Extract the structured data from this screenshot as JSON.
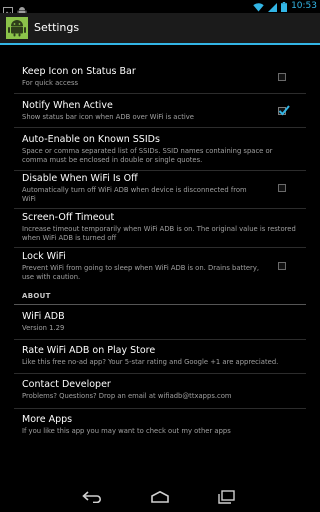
{
  "status_bar": {
    "time": "10:53"
  },
  "action_bar": {
    "title": "Settings"
  },
  "preferences": [
    {
      "title": "Keep Icon on Status Bar",
      "summary": "For quick access",
      "checked": false
    },
    {
      "title": "Notify When Active",
      "summary": "Show status bar icon when ADB over WiFi is active",
      "checked": true
    },
    {
      "title": "Auto-Enable on Known SSIDs",
      "summary": "Space or comma separated list of SSIDs. SSID names containing space or comma must be enclosed in double or single quotes."
    },
    {
      "title": "Disable When WiFi Is Off",
      "summary": "Automatically turn off WiFi ADB when device is disconnected from WiFi",
      "checked": false
    },
    {
      "title": "Screen-Off Timeout",
      "summary": "Increase timeout temporarily when WiFi ADB is on. The original value is restored when WiFi ADB is turned off"
    },
    {
      "title": "Lock WiFi",
      "summary": "Prevent WiFi from going to sleep when WiFi ADB is on. Drains battery, use with caution.",
      "checked": false
    }
  ],
  "about": {
    "header": "ABOUT",
    "items": [
      {
        "title": "WiFi ADB",
        "summary": "Version 1.29"
      },
      {
        "title": "Rate WiFi ADB on Play Store",
        "summary": "Like this free no-ad app? Your 5-star rating and Google +1 are appreciated."
      },
      {
        "title": "Contact Developer",
        "summary": "Problems? Questions? Drop an email at wifiadb@ttxapps.com"
      },
      {
        "title": "More Apps",
        "summary": "If you like this app you may want to check out my other apps"
      }
    ]
  },
  "icons": {
    "status_left": [
      "image-icon",
      "android-icon"
    ],
    "status_right": [
      "wifi-icon",
      "signal-icon",
      "battery-icon"
    ],
    "nav": [
      "back-icon",
      "home-icon",
      "recent-apps-icon"
    ]
  },
  "colors": {
    "accent": "#33b5e5",
    "background": "#000000",
    "app_icon": "#8bc34a"
  }
}
